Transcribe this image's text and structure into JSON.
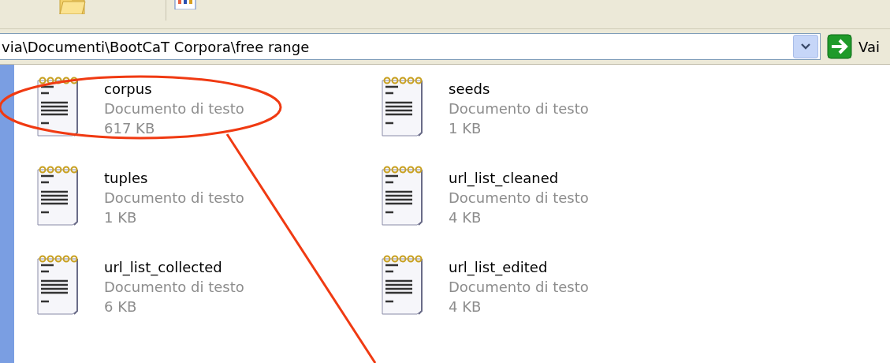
{
  "toolbar": {
    "buttons": [
      {
        "kind": "folders"
      },
      {
        "kind": "views"
      }
    ]
  },
  "address_bar": {
    "value": "via\\Documenti\\BootCaT Corpora\\free range",
    "go_label": "Vai"
  },
  "files": [
    {
      "name": "corpus",
      "type": "Documento di testo",
      "size": "617 KB"
    },
    {
      "name": "seeds",
      "type": "Documento di testo",
      "size": "1 KB"
    },
    {
      "name": "tuples",
      "type": "Documento di testo",
      "size": "1 KB"
    },
    {
      "name": "url_list_cleaned",
      "type": "Documento di testo",
      "size": "4 KB"
    },
    {
      "name": "url_list_collected",
      "type": "Documento di testo",
      "size": "6 KB"
    },
    {
      "name": "url_list_edited",
      "type": "Documento di testo",
      "size": "4 KB"
    }
  ]
}
